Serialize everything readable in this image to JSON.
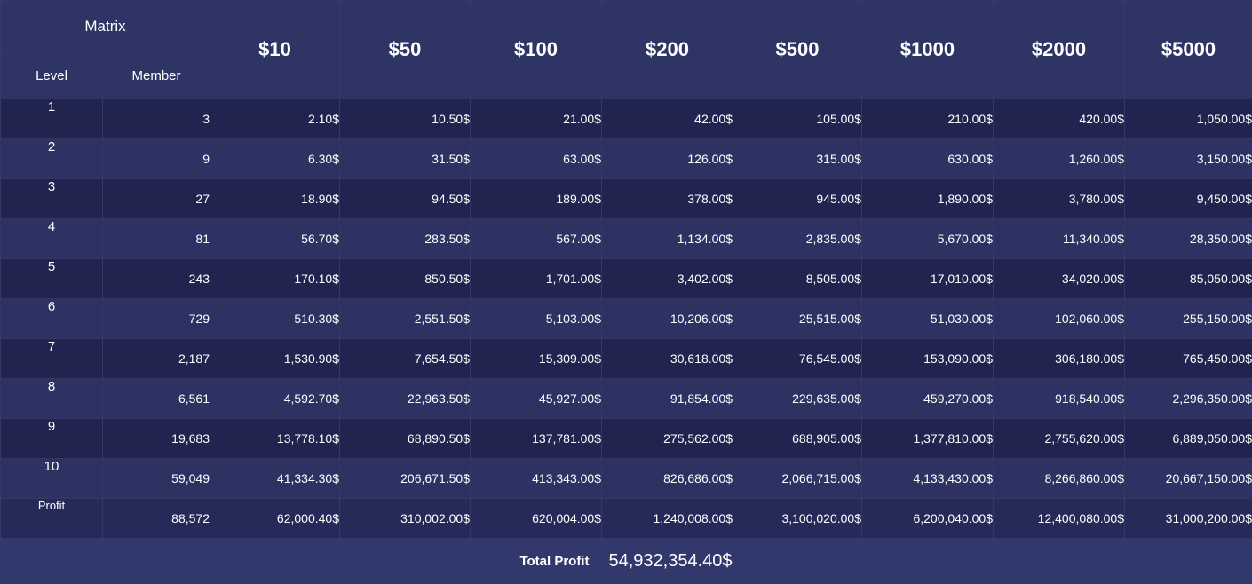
{
  "header": {
    "matrix": "Matrix",
    "level": "Level",
    "member": "Member",
    "prices": [
      "$10",
      "$50",
      "$100",
      "$200",
      "$500",
      "$1000",
      "$2000",
      "$5000"
    ]
  },
  "rows": [
    {
      "level": "1",
      "member": "3",
      "values": [
        "2.10$",
        "10.50$",
        "21.00$",
        "42.00$",
        "105.00$",
        "210.00$",
        "420.00$",
        "1,050.00$"
      ]
    },
    {
      "level": "2",
      "member": "9",
      "values": [
        "6.30$",
        "31.50$",
        "63.00$",
        "126.00$",
        "315.00$",
        "630.00$",
        "1,260.00$",
        "3,150.00$"
      ]
    },
    {
      "level": "3",
      "member": "27",
      "values": [
        "18.90$",
        "94.50$",
        "189.00$",
        "378.00$",
        "945.00$",
        "1,890.00$",
        "3,780.00$",
        "9,450.00$"
      ]
    },
    {
      "level": "4",
      "member": "81",
      "values": [
        "56.70$",
        "283.50$",
        "567.00$",
        "1,134.00$",
        "2,835.00$",
        "5,670.00$",
        "11,340.00$",
        "28,350.00$"
      ]
    },
    {
      "level": "5",
      "member": "243",
      "values": [
        "170.10$",
        "850.50$",
        "1,701.00$",
        "3,402.00$",
        "8,505.00$",
        "17,010.00$",
        "34,020.00$",
        "85,050.00$"
      ]
    },
    {
      "level": "6",
      "member": "729",
      "values": [
        "510.30$",
        "2,551.50$",
        "5,103.00$",
        "10,206.00$",
        "25,515.00$",
        "51,030.00$",
        "102,060.00$",
        "255,150.00$"
      ]
    },
    {
      "level": "7",
      "member": "2,187",
      "values": [
        "1,530.90$",
        "7,654.50$",
        "15,309.00$",
        "30,618.00$",
        "76,545.00$",
        "153,090.00$",
        "306,180.00$",
        "765,450.00$"
      ]
    },
    {
      "level": "8",
      "member": "6,561",
      "values": [
        "4,592.70$",
        "22,963.50$",
        "45,927.00$",
        "91,854.00$",
        "229,635.00$",
        "459,270.00$",
        "918,540.00$",
        "2,296,350.00$"
      ]
    },
    {
      "level": "9",
      "member": "19,683",
      "values": [
        "13,778.10$",
        "68,890.50$",
        "137,781.00$",
        "275,562.00$",
        "688,905.00$",
        "1,377,810.00$",
        "2,755,620.00$",
        "6,889,050.00$"
      ]
    },
    {
      "level": "10",
      "member": "59,049",
      "values": [
        "41,334.30$",
        "206,671.50$",
        "413,343.00$",
        "826,686.00$",
        "2,066,715.00$",
        "4,133,430.00$",
        "8,266,860.00$",
        "20,667,150.00$"
      ]
    }
  ],
  "profit": {
    "label": "Profit",
    "member": "88,572",
    "values": [
      "62,000.40$",
      "310,002.00$",
      "620,004.00$",
      "1,240,008.00$",
      "3,100,020.00$",
      "6,200,040.00$",
      "12,400,080.00$",
      "31,000,200.00$"
    ]
  },
  "total": {
    "label": "Total Profit",
    "value": "54,932,354.40$"
  }
}
